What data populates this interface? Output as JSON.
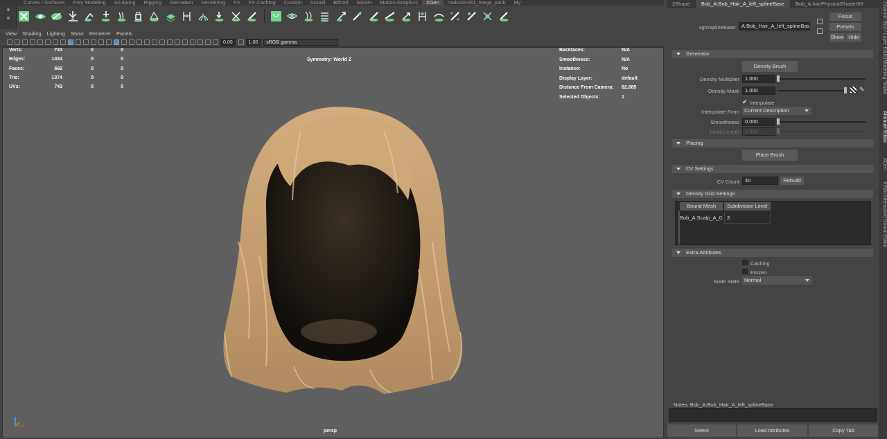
{
  "shelf": {
    "tabs": [
      "Curves / Surfaces",
      "Poly Modeling",
      "Sculpting",
      "Rigging",
      "Animation",
      "Rendering",
      "FX",
      "FX Caching",
      "Custom",
      "Arnold",
      "Bifrost",
      "MASH",
      "Motion Graphics",
      "XGen",
      "malcolm341_mega_pack",
      "My"
    ],
    "active_tab": "XGen"
  },
  "viewport": {
    "menus": [
      "View",
      "Shading",
      "Lighting",
      "Show",
      "Renderer",
      "Panels"
    ],
    "toolbar": {
      "value1": "0.00",
      "value2": "1.00",
      "color_space": "sRGB gamma"
    },
    "symmetry": "Symmetry: World Z",
    "camera_label": "persp",
    "hud_left": [
      {
        "label": "Verts:",
        "v1": "743",
        "v2": "0",
        "v3": "0"
      },
      {
        "label": "Edges:",
        "v1": "1434",
        "v2": "0",
        "v3": "0"
      },
      {
        "label": "Faces:",
        "v1": "692",
        "v2": "0",
        "v3": "0"
      },
      {
        "label": "Tris:",
        "v1": "1374",
        "v2": "0",
        "v3": "0"
      },
      {
        "label": "UVs:",
        "v1": "743",
        "v2": "0",
        "v3": "0"
      }
    ],
    "hud_right": [
      {
        "label": "Backfaces:",
        "value": "N/A"
      },
      {
        "label": "Smoothness:",
        "value": "N/A"
      },
      {
        "label": "Instance:",
        "value": "No"
      },
      {
        "label": "Display Layer:",
        "value": "default"
      },
      {
        "label": "Distance From Camera:",
        "value": "62.685"
      },
      {
        "label": "Selected Objects:",
        "value": "1"
      }
    ]
  },
  "attr": {
    "tabs": [
      "2Shape",
      "Bob_A:Bob_Hair_A_left_splineBase",
      "Bob_A:hairPhysicalShader98"
    ],
    "node_label": "xgmSplineBase:",
    "node_value": "A:Bob_Hair_A_left_splineBase",
    "focus": "Focus",
    "presets": "Presets",
    "show": "Show",
    "hide": "Hide",
    "generator": {
      "title": "Generator",
      "density_brush": "Density Brush",
      "density_multiplier_label": "Density Multiplier",
      "density_multiplier": "1.000",
      "density_mask_label": "Density Mask",
      "density_mask": "1.000",
      "interpolate": "Interpolate",
      "interpolate_from_label": "Interpolate From",
      "interpolate_from": "Current Description",
      "smoothness_label": "Smoothness",
      "smoothness": "0.000",
      "initial_length_label": "Initial Length",
      "initial_length": "1.000"
    },
    "placing": {
      "title": "Placing",
      "place_brush": "Place Brush"
    },
    "cv": {
      "title": "CV Settings",
      "label": "CV Count",
      "value": "40",
      "rebuild": "Rebuild"
    },
    "density_grid": {
      "title": "Density Grid Settings",
      "col1": "Bound Mesh",
      "col2": "Subdivision Level",
      "row_mesh": "Bob_A:Scalp_A_0...",
      "row_level": "3"
    },
    "extra": {
      "title": "Extra Attributes",
      "caching": "Caching",
      "frozen": "Frozen",
      "node_state_label": "Node State",
      "node_state": "Normal"
    },
    "notes": "Notes:  Bob_A:Bob_Hair_A_left_splineBase",
    "buttons": {
      "select": "Select",
      "load": "Load Attributes",
      "copy": "Copy Tab"
    }
  },
  "side_tabs": [
    "Channel Box / Layer Editor",
    "Modeling Toolkit",
    "Attribute Editor",
    "XGen",
    "XGen Interactive Groom Editor"
  ],
  "colors": {
    "hair": "#c7a072",
    "accent": "#5b8cb5",
    "icon": "#6fd38a"
  }
}
